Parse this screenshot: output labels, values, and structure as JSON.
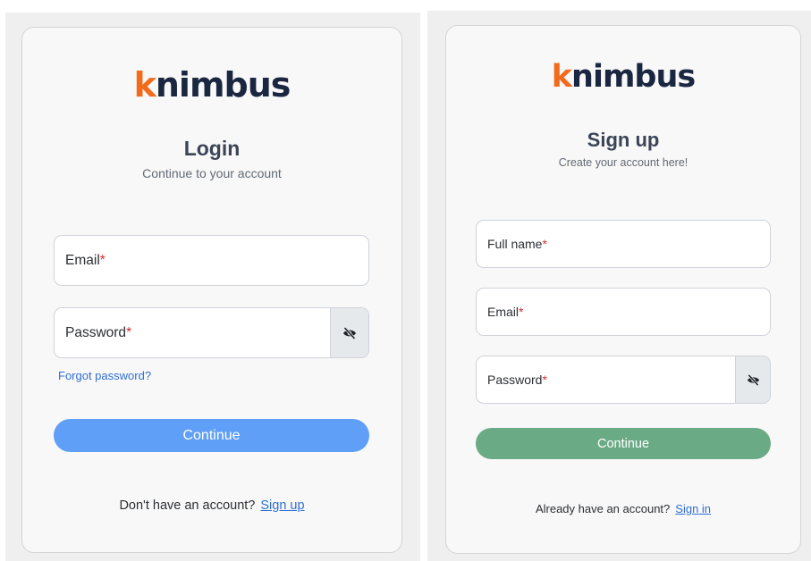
{
  "login": {
    "logo": {
      "k": "k",
      "rest": "nimbus"
    },
    "title": "Login",
    "subtitle": "Continue to your account",
    "email_label": "Email",
    "password_label": "Password",
    "required_marker": "*",
    "forgot_password": "Forgot password?",
    "continue_label": "Continue",
    "footer_text": "Don't have an account?",
    "footer_link": "Sign up",
    "eye_icon": "eye-off-icon",
    "button_color": "#5f9ff7"
  },
  "signup": {
    "logo": {
      "k": "k",
      "rest": "nimbus"
    },
    "title": "Sign up",
    "subtitle": "Create your account here!",
    "fullname_label": "Full name",
    "email_label": "Email",
    "password_label": "Password",
    "required_marker": "*",
    "continue_label": "Continue",
    "footer_text": "Already have an account?",
    "footer_link": "Sign in",
    "eye_icon": "eye-off-icon",
    "button_color": "#6aab86"
  },
  "colors": {
    "logo_k": "#f26b1d",
    "logo_text": "#1b2740",
    "required": "#d52b2b",
    "link": "#2f6fd4"
  }
}
